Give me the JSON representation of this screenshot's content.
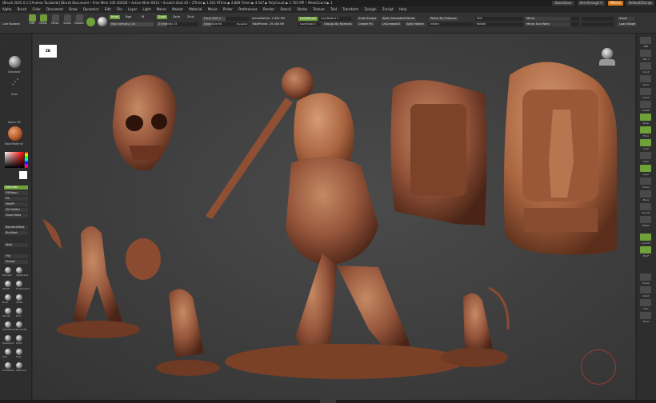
{
  "titlebar": {
    "title": "[Brush 2025.0.1] [Andrea Tarabella]   [Brush Document   • Free Mem 100.302GB • Active Mem 6614 • Scratch Disk 45 •  ZTime ▶ 1.921 RTime ▶ 4.889 Timer ▶ 4.547 ▶ PolyCount ▶ 1.705 MP • MeshCount ▶ 1",
    "quicksave": "QuickSave",
    "seethrough": "See-through  0",
    "menus": "Menus",
    "default_script": "DefaultZScript"
  },
  "menubar": [
    "Alpha",
    "Brush",
    "Color",
    "Document",
    "Draw",
    "Dynamics",
    "Edit",
    "File",
    "Layer",
    "Light",
    "Macro",
    "Marker",
    "Material",
    "Movie",
    "Picker",
    "Preferences",
    "Render",
    "Stencil",
    "Stroke",
    "Texture",
    "Tool",
    "Transform",
    "Zplugin",
    "Zscript",
    "Help"
  ],
  "toolbar": {
    "buttons": [
      {
        "label": "Edit",
        "icon": "edit-icon",
        "active": true
      },
      {
        "label": "Draw",
        "icon": "draw-icon",
        "active": true
      },
      {
        "label": "Move",
        "icon": "move-icon",
        "active": false
      },
      {
        "label": "Scale",
        "icon": "scale-icon",
        "active": false
      },
      {
        "label": "Rotate",
        "icon": "rotate-icon",
        "active": false
      }
    ],
    "mrgb": "Mrgb",
    "rgb": "Rgb",
    "m": "M",
    "rgb_intensity": "Rgb Intensity 100",
    "zadd": "Zadd",
    "zsub": "Zsub",
    "zcut": "Zcut",
    "z_intensity": "Z Intensity 25",
    "focal_shift": "Focal Shift 0",
    "draw_size": "Draw Size 64",
    "dynamic": "Dynamic",
    "active_points": "ActivePoints: 1.620 Mil",
    "total_points": "TotalPoints: 29.264 Mil",
    "lazymouse": "LazyMouse",
    "lazyradius": "LazyRadius 1",
    "lazysnap": "LazySnap 0",
    "groups_by_normals": "Groups By Normals",
    "auto_groups": "Auto Groups",
    "create_pg": "Create PG",
    "split_unmasked": "Split Unmasked Points",
    "uncreaseall": "UnCreaseAll",
    "split_hidden": "Split Hidden",
    "polish_by_features": "Polish By Features",
    "inflate": "Inflate",
    "size": "Size",
    "rotate": "Rotate",
    "mirror": "Mirror",
    "mirror_and_weld": "Mirror And Weld",
    "show": "Show",
    "load_stage": "Load Stage"
  },
  "leftpanel": {
    "lightbox": "Live Boolean",
    "brush_title": "Standard",
    "stroke_title": "Dots",
    "alpha_title": "Alpha Off",
    "texture_title": "Texture Off",
    "material_title": "BasicMaterial",
    "buttons": [
      {
        "label": "Alternate",
        "active": true
      },
      {
        "label": "FillObject",
        "active": false
      },
      {
        "label": "Fill",
        "active": false
      },
      {
        "label": "HideFP",
        "active": false
      },
      {
        "label": "Del Hidden",
        "active": false
      },
      {
        "label": "Close Holes",
        "active": false
      },
      {
        "label": "BackfaceMask",
        "active": false
      },
      {
        "label": "BlurMask",
        "active": false
      },
      {
        "label": "Weld",
        "active": false
      },
      {
        "label": "Flip",
        "active": false
      },
      {
        "label": "Double",
        "active": false
      }
    ],
    "brush_names": [
      "Standard",
      "ClayBuildup",
      "hPolish",
      "TrimDynamic",
      "Move",
      "Inflate",
      "Smooth",
      "Pinch",
      "DamStandard",
      "CurveTube",
      "Snakehook",
      "Polish",
      "Dam",
      "Slash",
      "CurveStrap",
      "ClipCurve"
    ]
  },
  "rightpanel": {
    "buttons": [
      "BPR",
      "SPix 3",
      "Scroll",
      "Zoom",
      "Actual",
      "AAHalf",
      "Persp",
      "Floor",
      "Local",
      "LSym",
      "Gxyz",
      "Frame",
      "Move",
      "ZoomD",
      "Rotate",
      "Line Fill",
      "PolyF",
      "Transp",
      "Ghost",
      "Solo",
      "Xpose"
    ]
  },
  "viewport": {
    "logo_text": "ZB"
  }
}
